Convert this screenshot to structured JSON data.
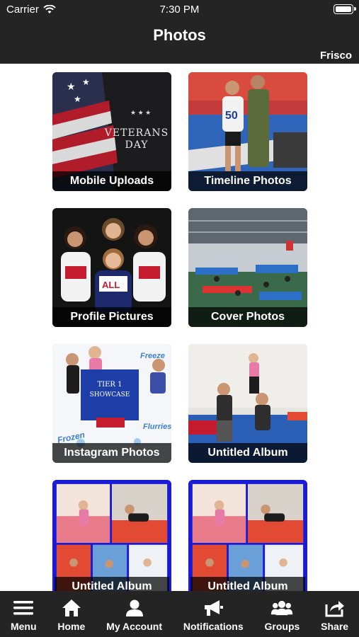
{
  "status_bar": {
    "carrier": "Carrier",
    "time": "7:30 PM"
  },
  "header": {
    "title": "Photos",
    "location": "Frisco"
  },
  "albums": [
    {
      "label": "Mobile Uploads"
    },
    {
      "label": "Timeline Photos"
    },
    {
      "label": "Profile Pictures"
    },
    {
      "label": "Cover Photos"
    },
    {
      "label": "Instagram Photos"
    },
    {
      "label": "Untitled Album"
    },
    {
      "label": "Untitled Album"
    },
    {
      "label": "Untitled Album"
    }
  ],
  "thumb_text": {
    "veterans_line1": "Veterans",
    "veterans_line2": "Day",
    "showcase_line1": "TIER 1",
    "showcase_line2": "SHOWCASE",
    "freeze": "Freeze",
    "frozen": "Frozen",
    "flurries": "Flurries"
  },
  "tabbar": {
    "items": [
      {
        "label": "Menu",
        "icon": "menu-icon"
      },
      {
        "label": "Home",
        "icon": "home-icon"
      },
      {
        "label": "My Account",
        "icon": "user-icon"
      },
      {
        "label": "Notifications",
        "icon": "megaphone-icon"
      },
      {
        "label": "Groups",
        "icon": "group-icon"
      },
      {
        "label": "Share",
        "icon": "share-icon"
      }
    ]
  },
  "colors": {
    "bar_bg": "#242424",
    "album_border": "#1a1ad6"
  }
}
